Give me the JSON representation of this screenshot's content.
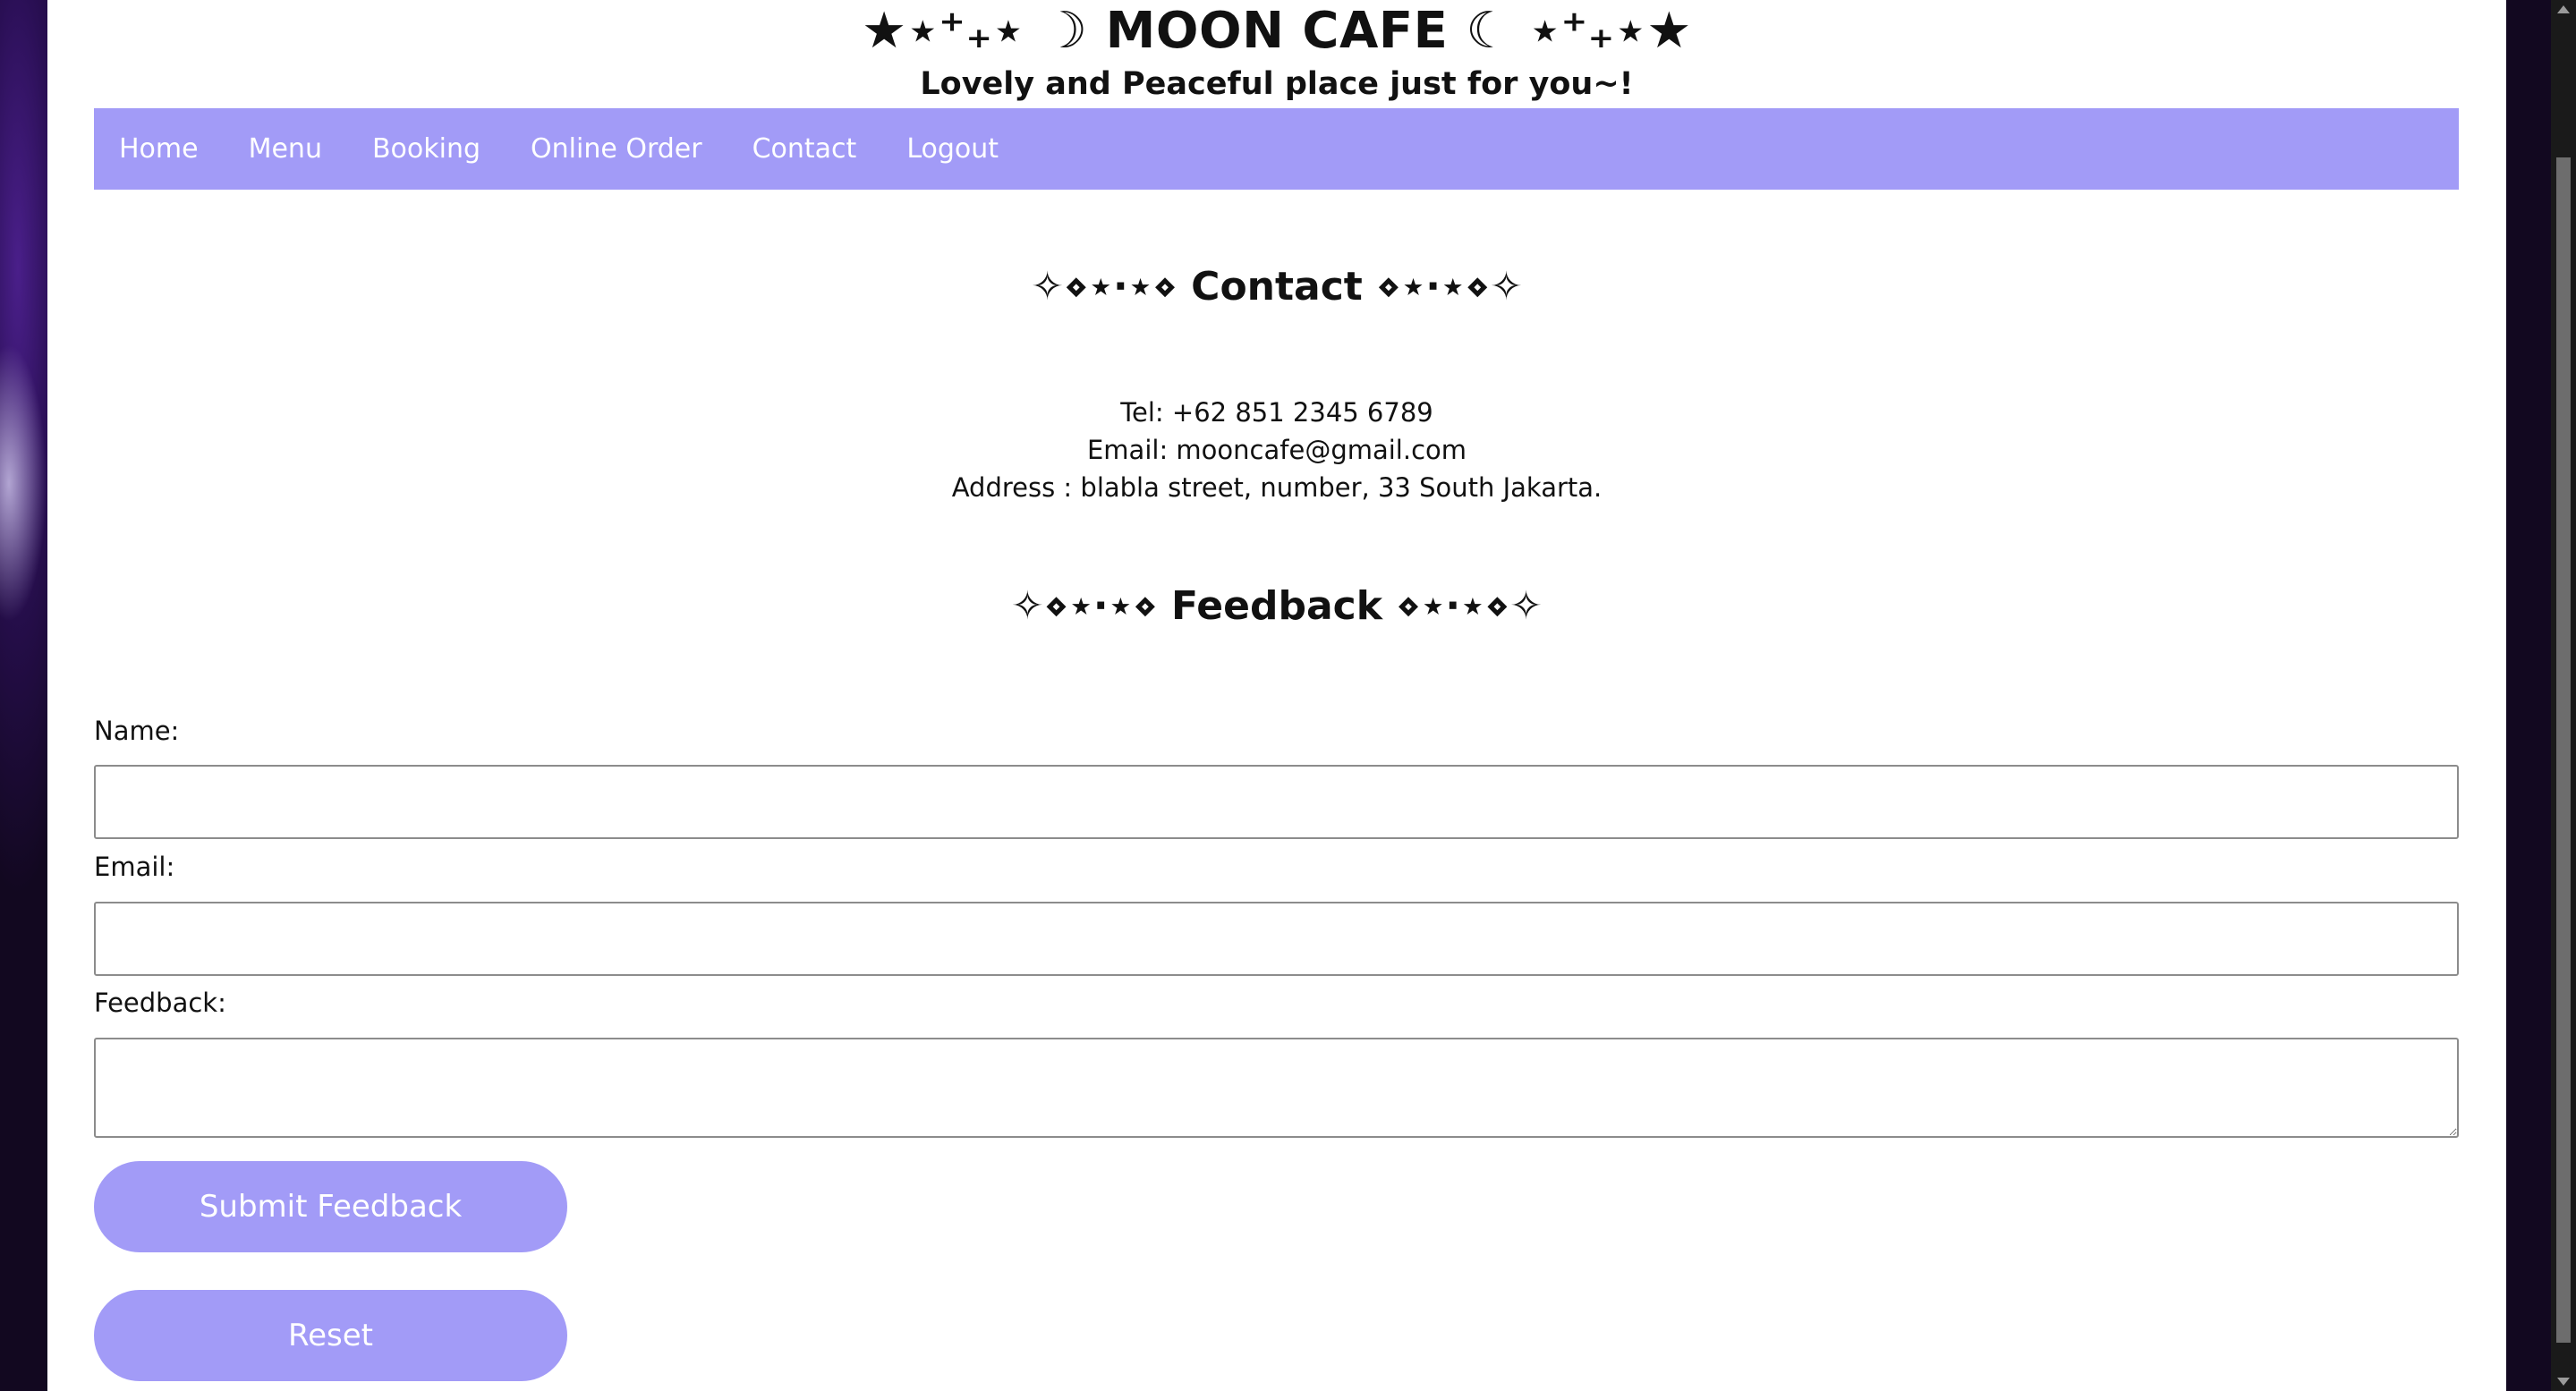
{
  "header": {
    "title": "★⋆⁺₊⋆ ☽ MOON CAFE ☾ ⋆⁺₊⋆★",
    "tagline": "Lovely and Peaceful place just for you~!"
  },
  "nav": {
    "items": [
      "Home",
      "Menu",
      "Booking",
      "Online Order",
      "Contact",
      "Logout"
    ]
  },
  "contact": {
    "heading": "✧⋄⋆⋅⋆⋄ Contact ⋄⋆⋅⋆⋄✧",
    "tel": "Tel: +62 851 2345 6789",
    "email": "Email: mooncafe@gmail.com",
    "address": "Address : blabla street, number, 33 South Jakarta."
  },
  "feedback": {
    "heading": "✧⋄⋆⋅⋆⋄ Feedback ⋄⋆⋅⋆⋄✧",
    "name_label": "Name:",
    "name_value": "",
    "email_label": "Email:",
    "email_value": "",
    "feedback_label": "Feedback:",
    "feedback_value": "",
    "submit_label": "Submit Feedback",
    "reset_label": "Reset"
  },
  "colors": {
    "accent": "#a29bf7",
    "page_background": "#ffffff",
    "text": "#111111"
  }
}
